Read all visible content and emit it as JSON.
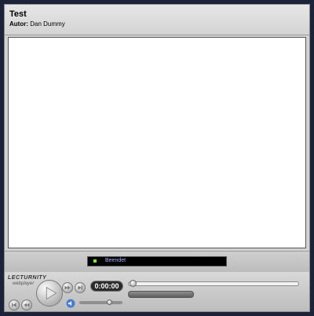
{
  "header": {
    "title": "Test",
    "author_label": "Autor:",
    "author_name": "Dan Dummy"
  },
  "status": {
    "text": "Beendet",
    "led_color": "#7ff02a"
  },
  "player": {
    "logo": "LECTURNITY",
    "logo_sub": "webplayer",
    "time": "0:00:00",
    "timeline_position": 0.0,
    "volume_level": 0.7
  },
  "colors": {
    "background": "#1c2238",
    "frame": "#d2d2d2",
    "slide": "#ffffff"
  },
  "icons": [
    "play-icon",
    "fast-forward-icon",
    "skip-end-icon",
    "skip-start-icon",
    "rewind-icon",
    "speaker-icon"
  ]
}
